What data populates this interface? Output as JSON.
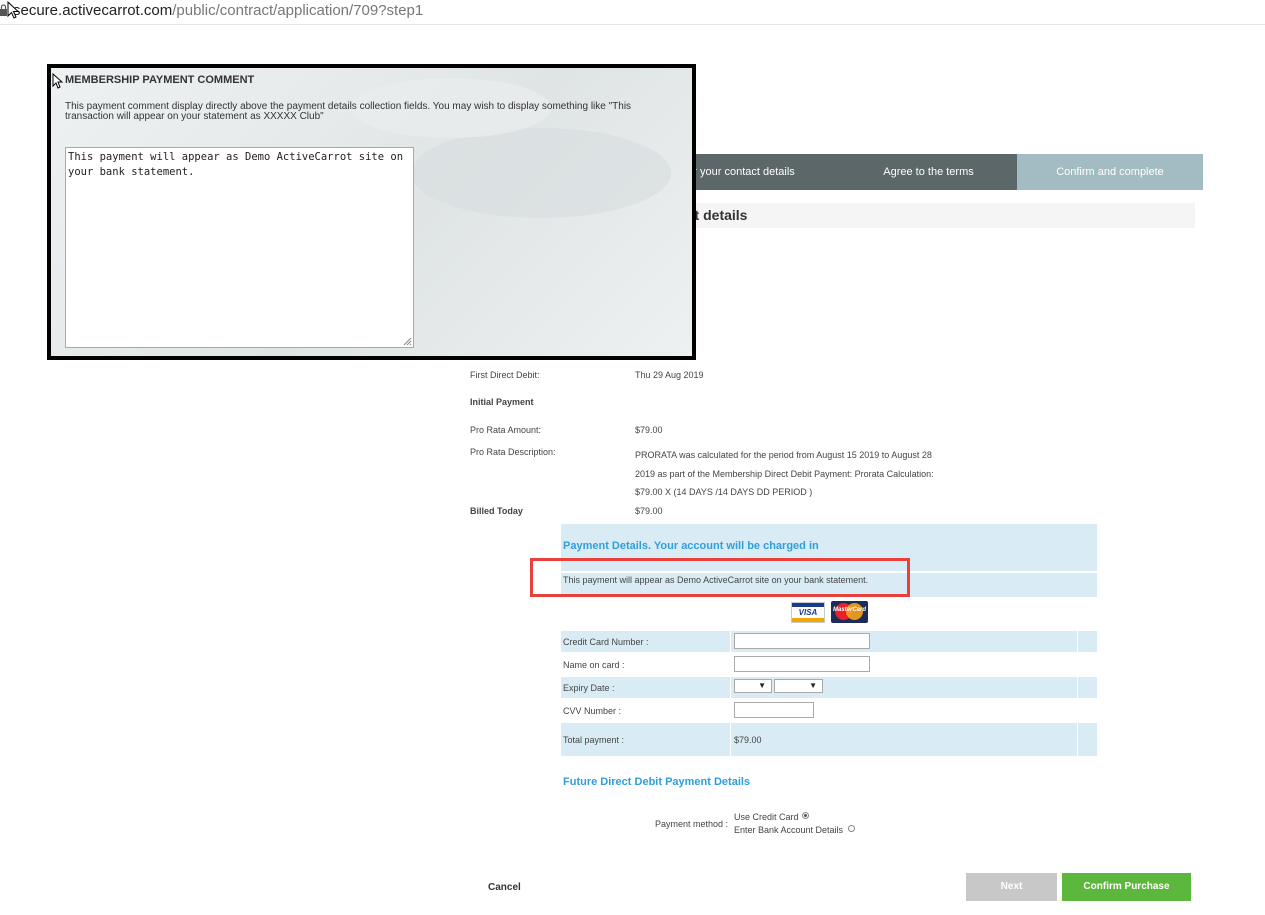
{
  "browser": {
    "url_host": "secure.activecarrot.com",
    "url_path": "/public/contract/application/709?step1"
  },
  "steps": [
    {
      "label": "er your contact details"
    },
    {
      "label": "Agree to the terms"
    },
    {
      "label": "Confirm and complete"
    }
  ],
  "section": {
    "title": "nt details"
  },
  "info": {
    "first_dd_label": "First Direct Debit:",
    "first_dd_value": "Thu 29 Aug 2019",
    "initial_payment_label": "Initial Payment",
    "pro_rata_amount_label": "Pro Rata Amount:",
    "pro_rata_amount_value": "$79.00",
    "pro_rata_desc_label": "Pro Rata Description:",
    "pro_rata_desc_line1": "PRORATA was calculated for the period from August 15 2019 to August 28",
    "pro_rata_desc_line2": "2019 as part of the Membership Direct Debit Payment: Prorata Calculation:",
    "pro_rata_desc_line3": "$79.00 X (14 DAYS /14 DAYS DD PERIOD )",
    "billed_today_label": "Billed Today",
    "billed_today_value": "$79.00"
  },
  "payment": {
    "heading": "Payment Details. Your account will be charged in",
    "comment": "This payment will appear as Demo ActiveCarrot site on your bank statement.",
    "card_visa": "VISA",
    "card_mc": "MasterCard",
    "cc_number_label": "Credit Card Number :",
    "name_label": "Name on card :",
    "expiry_label": "Expiry Date :",
    "cvv_label": "CVV Number :",
    "total_label": "Total payment :",
    "total_value": "$79.00",
    "expiry_arrow": "▼"
  },
  "future": {
    "heading": "Future Direct Debit Payment Details",
    "method_label": "Payment method :",
    "option_card": "Use Credit Card",
    "option_bank": "Enter Bank Account Details"
  },
  "actions": {
    "cancel": "Cancel",
    "next": "Next",
    "confirm": "Confirm Purchase"
  },
  "modal": {
    "title": "MEMBERSHIP PAYMENT COMMENT",
    "description": "This payment comment display directly above the payment details collection fields. You may wish to display something like \"This transaction will appear on your statement as XXXXX Club\"",
    "textarea_value": "This payment will appear as Demo ActiveCarrot site on your bank statement."
  },
  "colors": {
    "accent_blue": "#2f9fda",
    "row_blue": "#d9ecf6",
    "step_dark": "#5b6769",
    "step_active": "#a3bcc3",
    "confirm_green": "#5cb83c",
    "highlight_red": "#e8413c"
  }
}
